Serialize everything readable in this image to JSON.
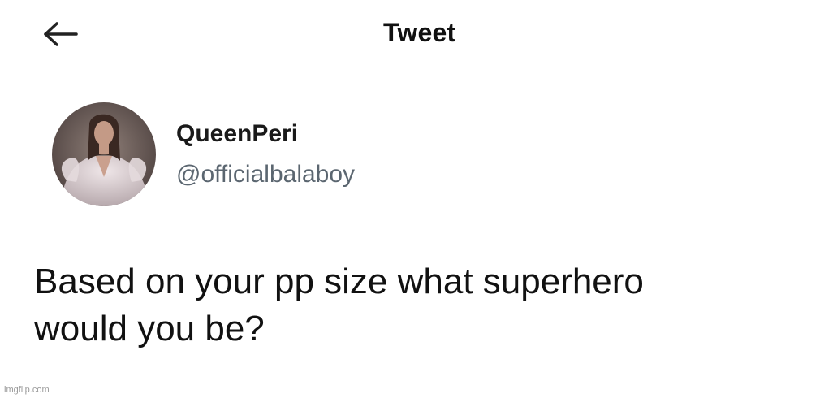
{
  "header": {
    "back_icon": "arrow-left-icon",
    "title": "Tweet"
  },
  "author": {
    "display_name": "QueenPeri",
    "handle": "@officialbalaboy"
  },
  "tweet": {
    "text_line_1": "Based on your pp size what superhero",
    "text_line_2": "would you be?"
  },
  "watermark": "imgflip.com",
  "colors": {
    "background": "#ffffff",
    "text_primary": "#0f1419",
    "text_secondary": "#5b6670"
  }
}
